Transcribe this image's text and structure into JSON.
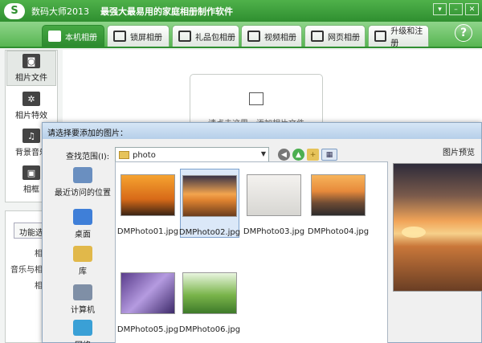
{
  "app": {
    "logo_text": "S",
    "title": "数码大师2013",
    "slogan": "最强大最易用的家庭相册制作软件",
    "window_controls": [
      "▾",
      "–",
      "✕"
    ]
  },
  "tabs": [
    {
      "label": "本机相册",
      "active": true
    },
    {
      "label": "锁屏相册",
      "active": false
    },
    {
      "label": "礼品包相册",
      "active": false
    },
    {
      "label": "视频相册",
      "active": false
    },
    {
      "label": "网页相册",
      "active": false
    },
    {
      "label": "升级和注册",
      "active": false
    }
  ],
  "help_label": "?",
  "sidebar": {
    "items": [
      {
        "label": "相片文件",
        "icon": "camera-icon",
        "glyph": "◙"
      },
      {
        "label": "相片特效",
        "icon": "effects-icon",
        "glyph": "✲"
      },
      {
        "label": "背景音乐",
        "icon": "music-icon",
        "glyph": "♫"
      },
      {
        "label": "相框",
        "icon": "frame-icon",
        "glyph": "▣"
      }
    ]
  },
  "lower_panel": {
    "tab_label": "功能选项",
    "lines": [
      "相册",
      "音乐与相册",
      "相册"
    ]
  },
  "canvas": {
    "drop_hint": "请点击这里，添加相片文件"
  },
  "dialog": {
    "title": "请选择要添加的图片：",
    "lookin_label": "查找范围(I):",
    "lookin_value": "photo",
    "places": [
      {
        "label": "最近访问的位置",
        "color": "#6a8fc0"
      },
      {
        "label": "桌面",
        "color": "#3f7fd8"
      },
      {
        "label": "库",
        "color": "#e1b84a"
      },
      {
        "label": "计算机",
        "color": "#7f8fa6"
      },
      {
        "label": "网络",
        "color": "#3aa0d6"
      }
    ],
    "files": [
      {
        "name": "DMPhoto01.jpg",
        "selected": false,
        "palette": "linear-gradient(#f6a330, #d86a18 60%, #3b2414)"
      },
      {
        "name": "DMPhoto02.jpg",
        "selected": true,
        "palette": "linear-gradient(#3a3448, #f2a44e 45%, #e08330 60%, #6b3d1e)"
      },
      {
        "name": "DMPhoto03.jpg",
        "selected": false,
        "palette": "linear-gradient(#f4f2ef, #d7d6d2)"
      },
      {
        "name": "DMPhoto04.jpg",
        "selected": false,
        "palette": "linear-gradient(#f7b45b, #e78a3b 40%, #6c4a34 70%, #2d2b2b)"
      },
      {
        "name": "DMPhoto05.jpg",
        "selected": false,
        "palette": "linear-gradient(135deg, #5a3d8c, #b59be0 50%, #3d2a6a)"
      },
      {
        "name": "DMPhoto06.jpg",
        "selected": false,
        "palette": "linear-gradient(#e9f5df, #79b44a 55%, #3e7a2a)"
      }
    ],
    "preview_label": "图片预览"
  }
}
